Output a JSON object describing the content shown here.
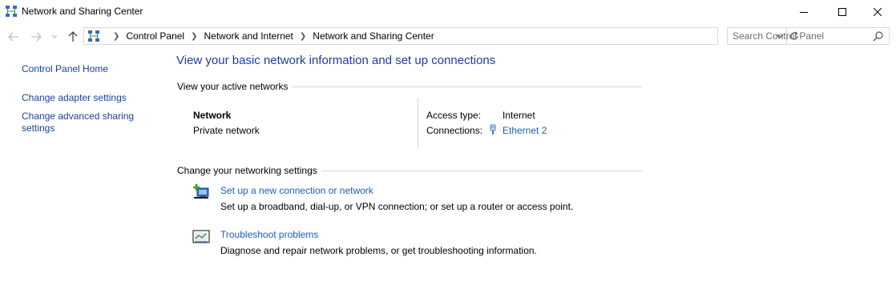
{
  "window": {
    "title": "Network and Sharing Center",
    "title_icon": "network-center-icon",
    "controls": [
      "minimize-icon",
      "maximize-icon",
      "close-icon"
    ]
  },
  "nav": {
    "back_icon": "back-arrow-icon",
    "forward_icon": "forward-arrow-icon",
    "recent_icon": "chevron-down-icon",
    "up_icon": "up-arrow-icon"
  },
  "address": {
    "location_icon": "network-center-icon",
    "breadcrumbs": [
      "Control Panel",
      "Network and Internet",
      "Network and Sharing Center"
    ],
    "dropdown_icon": "chevron-down-icon",
    "refresh_icon": "refresh-icon"
  },
  "search": {
    "placeholder": "Search Control Panel",
    "value": "",
    "icon": "search-icon"
  },
  "sidebar": {
    "items": [
      {
        "label": "Control Panel Home"
      },
      {
        "label": "Change adapter settings"
      },
      {
        "label": "Change advanced sharing settings"
      }
    ]
  },
  "main": {
    "heading": "View your basic network information and set up connections",
    "active_networks": {
      "section_label": "View your active networks",
      "network_name": "Network",
      "network_type": "Private network",
      "access_type_label": "Access type:",
      "access_type_value": "Internet",
      "connections_label": "Connections:",
      "connections_value": "Ethernet 2",
      "connections_icon": "ethernet-icon"
    },
    "networking_settings": {
      "section_label": "Change your networking settings",
      "tasks": [
        {
          "icon": "new-connection-icon",
          "title": "Set up a new connection or network",
          "description": "Set up a broadband, dial-up, or VPN connection; or set up a router or access point."
        },
        {
          "icon": "troubleshoot-icon",
          "title": "Troubleshoot problems",
          "description": "Diagnose and repair network problems, or get troubleshooting information."
        }
      ]
    }
  },
  "colors": {
    "link": "#1c5fb5",
    "heading": "#1e3d99",
    "nav_link": "#1c3f95",
    "divider": "#d6d6d6"
  }
}
